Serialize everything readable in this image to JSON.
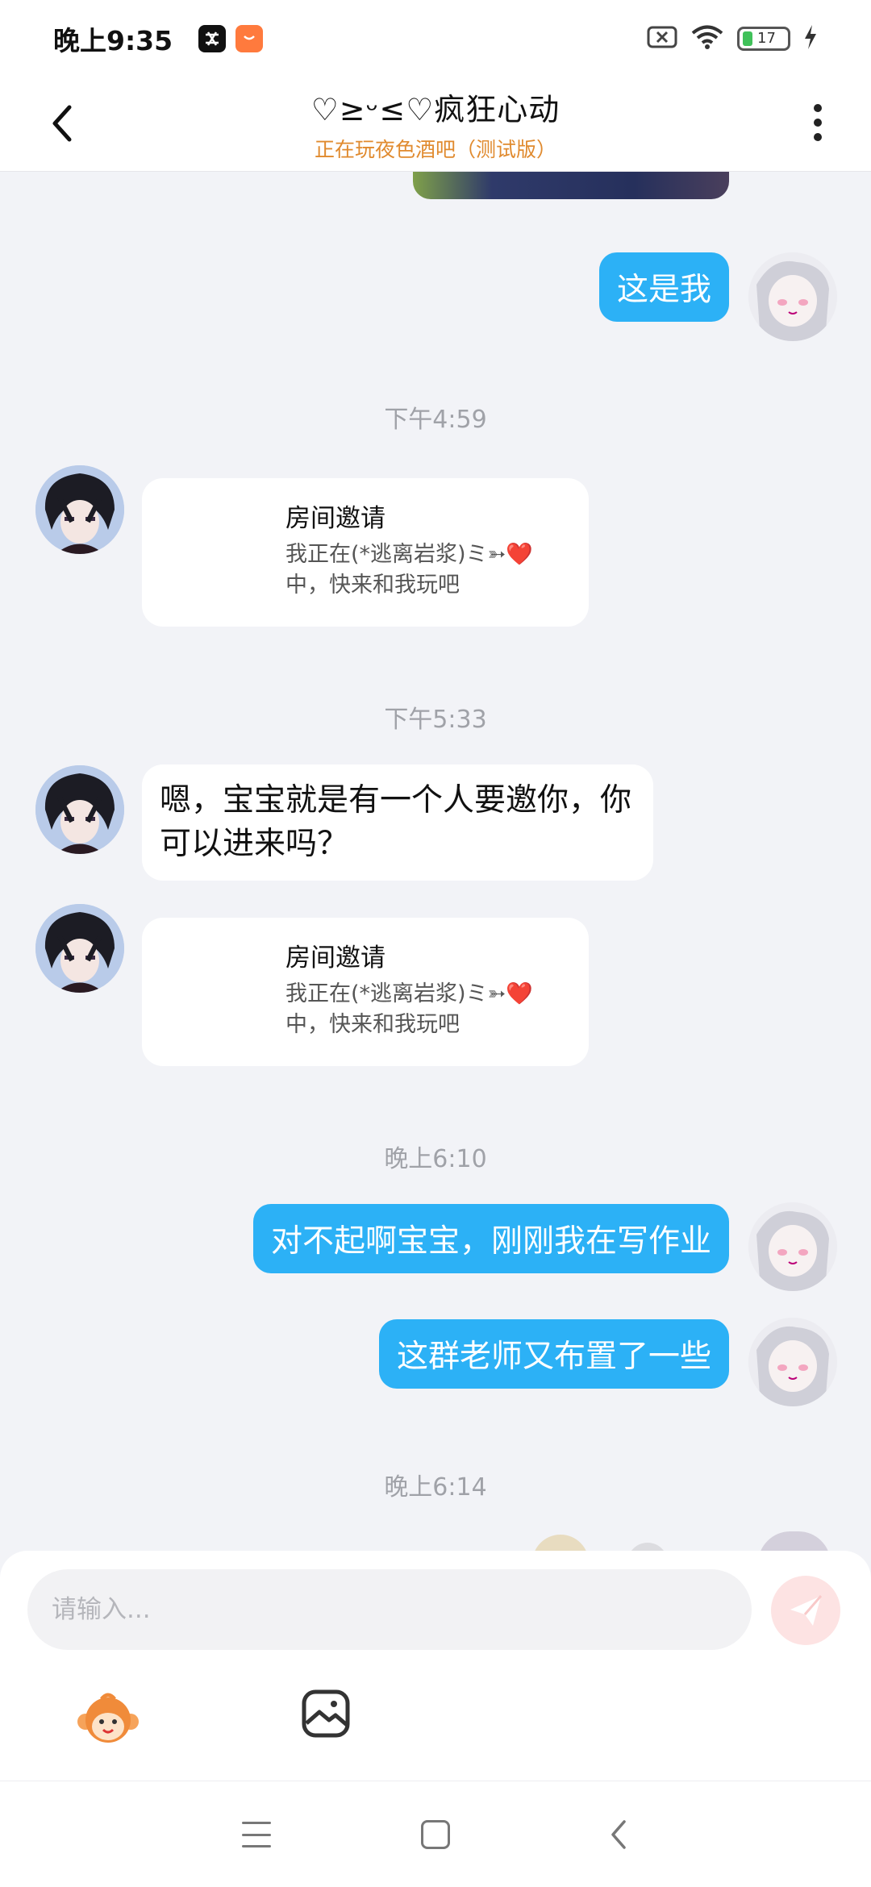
{
  "status_bar": {
    "time": "晚上9:35",
    "battery": "17"
  },
  "header": {
    "title": "♡≥ᵕ≤♡疯狂心动",
    "subtitle": "正在玩夜色酒吧（测试版）"
  },
  "messages": {
    "m1": "这是我",
    "ts1": "下午4:59",
    "invite1": {
      "title": "房间邀请",
      "desc": "我正在(*逃离岩浆)ミ➳❤️中，快来和我玩吧"
    },
    "ts2": "下午5:33",
    "m2": "嗯，宝宝就是有一个人要邀你，你可以进来吗？",
    "invite2": {
      "title": "房间邀请",
      "desc": "我正在(*逃离岩浆)ミ➳❤️中，快来和我玩吧"
    },
    "ts3": "晚上6:10",
    "m3": "对不起啊宝宝，刚刚我在写作业",
    "m4": "这群老师又布置了一些",
    "ts4": "晚上6:14"
  },
  "input": {
    "placeholder": "请输入..."
  },
  "colors": {
    "accent_blue": "#2cb1f6",
    "subtitle_orange": "#e08a2e",
    "send_disabled": "#fde3e3"
  }
}
